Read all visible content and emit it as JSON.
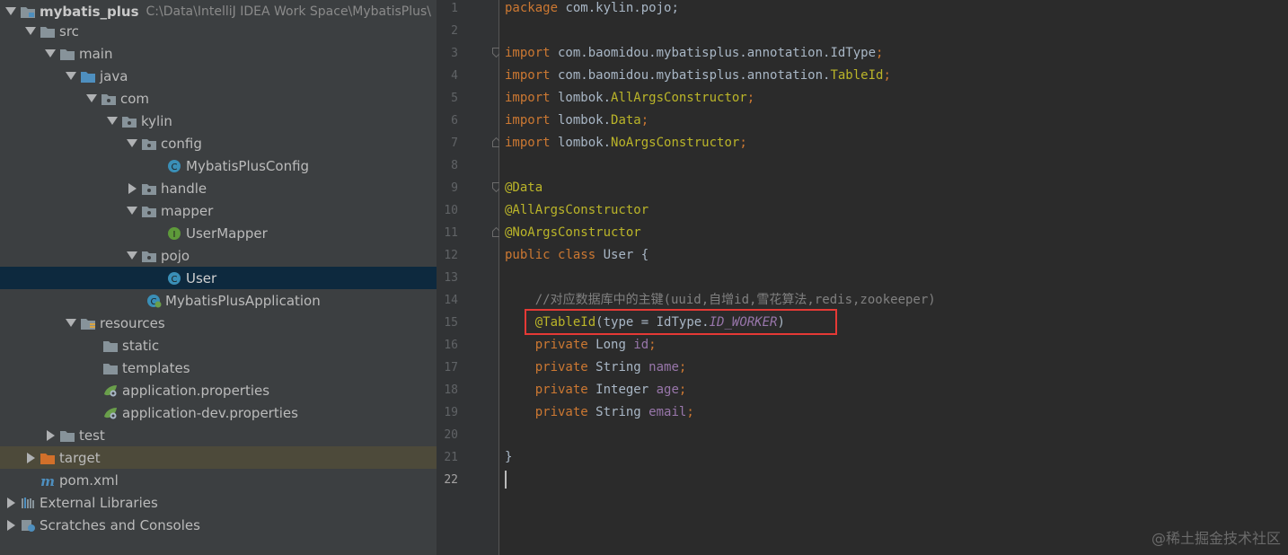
{
  "project": {
    "name": "mybatis_plus",
    "path": "C:\\Data\\IntelliJ IDEA Work Space\\MybatisPlus\\"
  },
  "tree": [
    {
      "label": "src",
      "icon": "folder-icon",
      "expanded": true
    },
    {
      "label": "main",
      "icon": "folder-icon",
      "expanded": true
    },
    {
      "label": "java",
      "icon": "source-folder-icon",
      "expanded": true
    },
    {
      "label": "com",
      "icon": "package-icon",
      "expanded": true
    },
    {
      "label": "kylin",
      "icon": "package-icon",
      "expanded": true
    },
    {
      "label": "config",
      "icon": "package-icon",
      "expanded": true
    },
    {
      "label": "MybatisPlusConfig",
      "icon": "class-icon"
    },
    {
      "label": "handle",
      "icon": "package-icon",
      "expanded": false
    },
    {
      "label": "mapper",
      "icon": "package-icon",
      "expanded": true
    },
    {
      "label": "UserMapper",
      "icon": "interface-icon"
    },
    {
      "label": "pojo",
      "icon": "package-icon",
      "expanded": true
    },
    {
      "label": "User",
      "icon": "class-icon",
      "selected": true
    },
    {
      "label": "MybatisPlusApplication",
      "icon": "spring-boot-class-icon"
    },
    {
      "label": "resources",
      "icon": "resources-folder-icon",
      "expanded": true
    },
    {
      "label": "static",
      "icon": "folder-icon"
    },
    {
      "label": "templates",
      "icon": "folder-icon"
    },
    {
      "label": "application.properties",
      "icon": "spring-properties-icon"
    },
    {
      "label": "application-dev.properties",
      "icon": "spring-properties-icon"
    },
    {
      "label": "test",
      "icon": "folder-icon",
      "expanded": false
    },
    {
      "label": "target",
      "icon": "excluded-folder-icon",
      "expanded": false
    },
    {
      "label": "pom.xml",
      "icon": "maven-icon"
    },
    {
      "label": "External Libraries",
      "icon": "libraries-icon",
      "expanded": false
    },
    {
      "label": "Scratches and Consoles",
      "icon": "scratches-icon",
      "expanded": false
    }
  ],
  "code": {
    "line_numbers": [
      "1",
      "2",
      "3",
      "4",
      "5",
      "6",
      "7",
      "8",
      "9",
      "10",
      "11",
      "12",
      "13",
      "14",
      "15",
      "16",
      "17",
      "18",
      "19",
      "20",
      "21",
      "22"
    ],
    "current_line": "22",
    "l1": {
      "kw": "package",
      "rest": " com.kylin.pojo;"
    },
    "l3": {
      "kw": "import",
      "pkg": " com.baomidou.mybatisplus.annotation.",
      "cls": "IdType",
      "end": ";"
    },
    "l4": {
      "kw": "import",
      "pkg": " com.baomidou.mybatisplus.annotation.",
      "cls": "TableId",
      "end": ";"
    },
    "l5": {
      "kw": "import",
      "pkg": " lombok.",
      "cls": "AllArgsConstructor",
      "end": ";"
    },
    "l6": {
      "kw": "import",
      "pkg": " lombok.",
      "cls": "Data",
      "end": ";"
    },
    "l7": {
      "kw": "import",
      "pkg": " lombok.",
      "cls": "NoArgsConstructor",
      "end": ";"
    },
    "l9": "@Data",
    "l10": "@AllArgsConstructor",
    "l11": "@NoArgsConstructor",
    "l12": {
      "kw1": "public",
      "kw2": "class",
      "name": " User {"
    },
    "l14": "    //对应数据库中的主键(uuid,自增id,雪花算法,redis,zookeeper)",
    "l15": {
      "ann": "@TableId",
      "open": "(",
      "param": "type",
      "eq": " = IdType.",
      "const": "ID_WORKER",
      "close": ")"
    },
    "fields": [
      {
        "kw": "private",
        "type": " Long ",
        "name": "id",
        "end": ";"
      },
      {
        "kw": "private",
        "type": " String ",
        "name": "name",
        "end": ";"
      },
      {
        "kw": "private",
        "type": " Integer ",
        "name": "age",
        "end": ";"
      },
      {
        "kw": "private",
        "type": " String ",
        "name": "email",
        "end": ";"
      }
    ],
    "l21": "}"
  },
  "watermark": "@稀土掘金技术社区",
  "colors": {
    "keyword": "#cc7832",
    "annotation": "#bbb529",
    "field": "#9876aa",
    "comment": "#808080",
    "highlight_box": "#e53935",
    "selection": "#0d293e"
  }
}
